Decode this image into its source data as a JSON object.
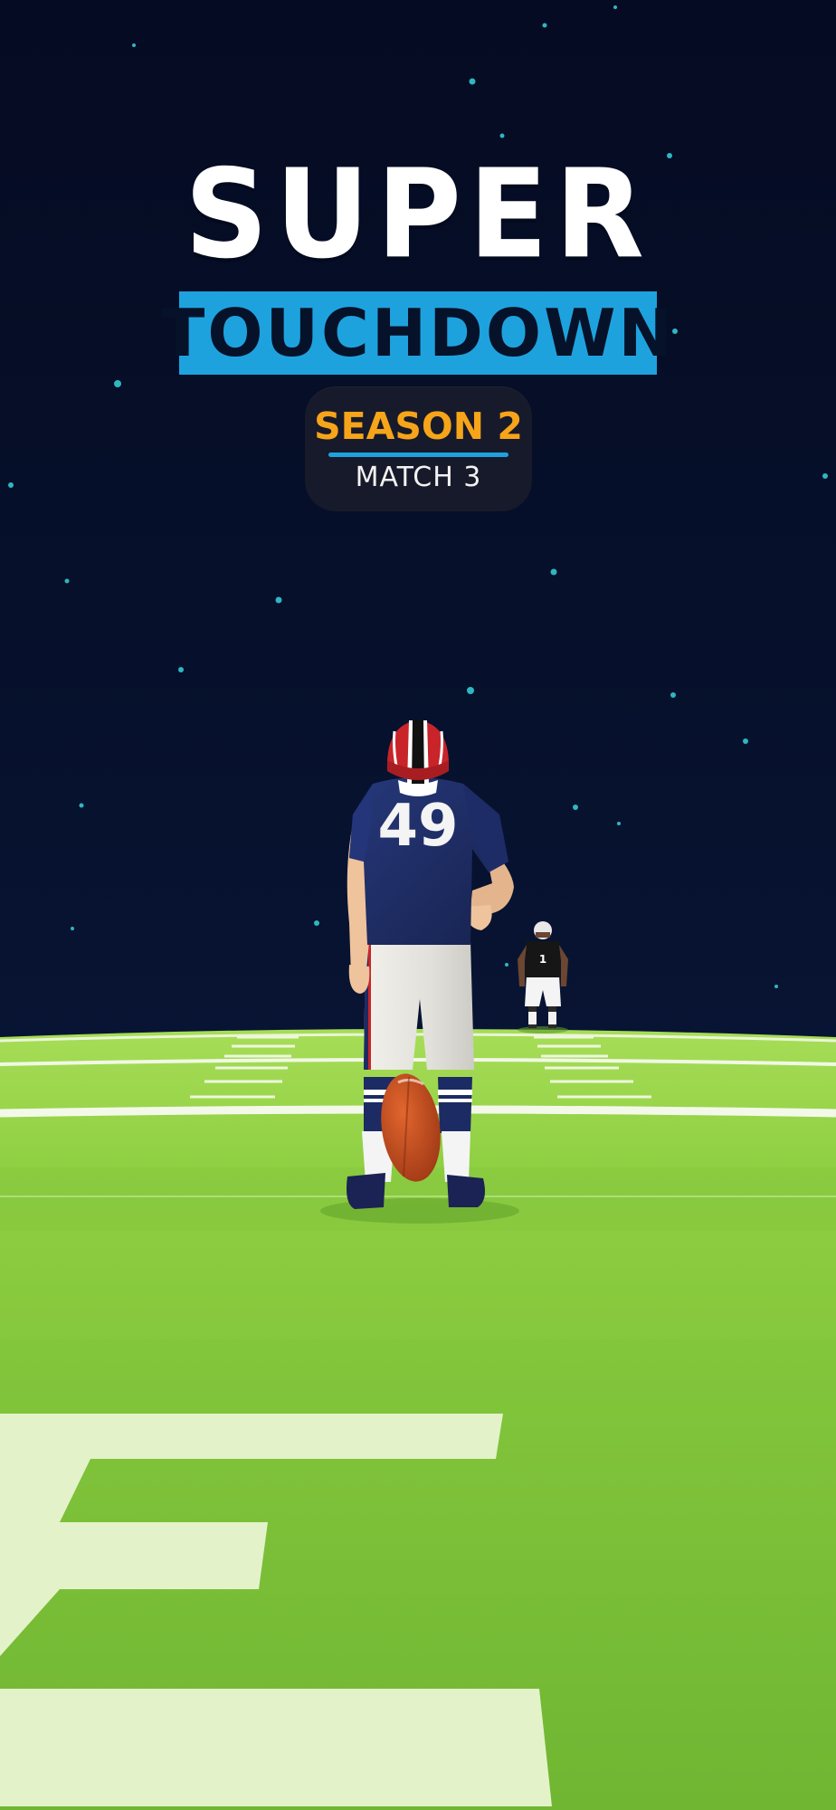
{
  "title": {
    "line1": "SUPER",
    "line2": "TOUCHDOWN"
  },
  "match_panel": {
    "season": "SEASON 2",
    "match": "MATCH 3"
  },
  "players": {
    "kicker_number": "49",
    "opponent_number": "1"
  },
  "colors": {
    "sky": "#050b22",
    "accent_blue": "#1ea2de",
    "season_orange": "#f6a41a",
    "panel_bg": "#171a2a",
    "field_green": "#86c83a",
    "jersey_navy": "#1c2b63"
  },
  "icons": [
    "football-ball-icon",
    "helmet-icon"
  ]
}
